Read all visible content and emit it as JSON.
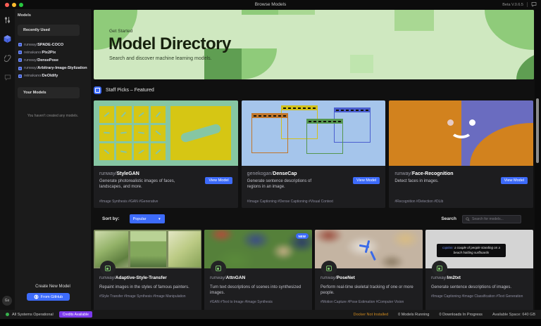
{
  "titlebar": {
    "title": "Browse Models",
    "version": "Beta V.0.6.5"
  },
  "sidebar": {
    "header": "Models",
    "recently_used": "Recently Used",
    "recent": [
      {
        "owner": "runway/",
        "name": "SPADE-COCO"
      },
      {
        "owner": "reinakano/",
        "name": "Pix2Pix"
      },
      {
        "owner": "runway/",
        "name": "DensePose"
      },
      {
        "owner": "runway/",
        "name": "Arbitrary-Image-Stylization"
      },
      {
        "owner": "reinakano/",
        "name": "DeOldify"
      }
    ],
    "your_models": "Your Models",
    "empty": "You haven't created any models.",
    "create": "Create New Model",
    "github": "From GitHub",
    "avatar": "Gs"
  },
  "hero": {
    "eyebrow": "Get Started",
    "title": "Model Directory",
    "subtitle": "Search and discover machine learning models."
  },
  "sections": {
    "staff_picks": "Staff Picks – Featured"
  },
  "featured": [
    {
      "owner": "runway/",
      "name": "StyleGAN",
      "description": "Generate photorealistic images of faces, landscapes, and more.",
      "tags": "#Image Synthesis #GAN #Generative",
      "button": "View Model"
    },
    {
      "owner": "genekogan/",
      "name": "DenseCap",
      "description": "Generate sentence descriptions of regions in an image.",
      "tags": "#Image Captioning #Dense Captioning #Visual Context",
      "button": "View Model"
    },
    {
      "owner": "runway/",
      "name": "Face-Recognition",
      "description": "Detect faces in images.",
      "tags": "#Recognition #Detection #DLib",
      "button": "View Model"
    }
  ],
  "toolbar": {
    "sort_label": "Sort by:",
    "sort_value": "Popular",
    "search_label": "Search",
    "search_placeholder": "Search for models..."
  },
  "models": [
    {
      "owner": "runway/",
      "name": "Adaptive-Style-Transfer",
      "description": "Repaint images in the styles of famous painters.",
      "tags": "#Style Transfer #Image Synthesis #Image Manipulation"
    },
    {
      "owner": "runway/",
      "name": "AttnGAN",
      "badge": "NEW",
      "description": "Turn text descriptions of scenes into synthesized images.",
      "tags": "#GAN #Text to Image #Image Synthesis"
    },
    {
      "owner": "runway/",
      "name": "PoseNet",
      "description": "Perform real-time skeletal tracking of one or more people.",
      "tags": "#Motion Capture #Pose Estimation #Computer Vision"
    },
    {
      "owner": "runway/",
      "name": "Im2txt",
      "description": "Generate sentence descriptions of images.",
      "tags": "#Image Captioning #Image Classification #Text Generation",
      "caption_label": "caption:",
      "caption_text": "a couple of people standing on a beach holding surfboards"
    }
  ],
  "statusbar": {
    "system": "All Systems Operational",
    "credits": "Credits Available",
    "docker": "Docker Not Installed",
    "models_running": "0 Models Running",
    "downloads": "0 Downloads In Progress",
    "space": "Available Space: 640 GB"
  }
}
